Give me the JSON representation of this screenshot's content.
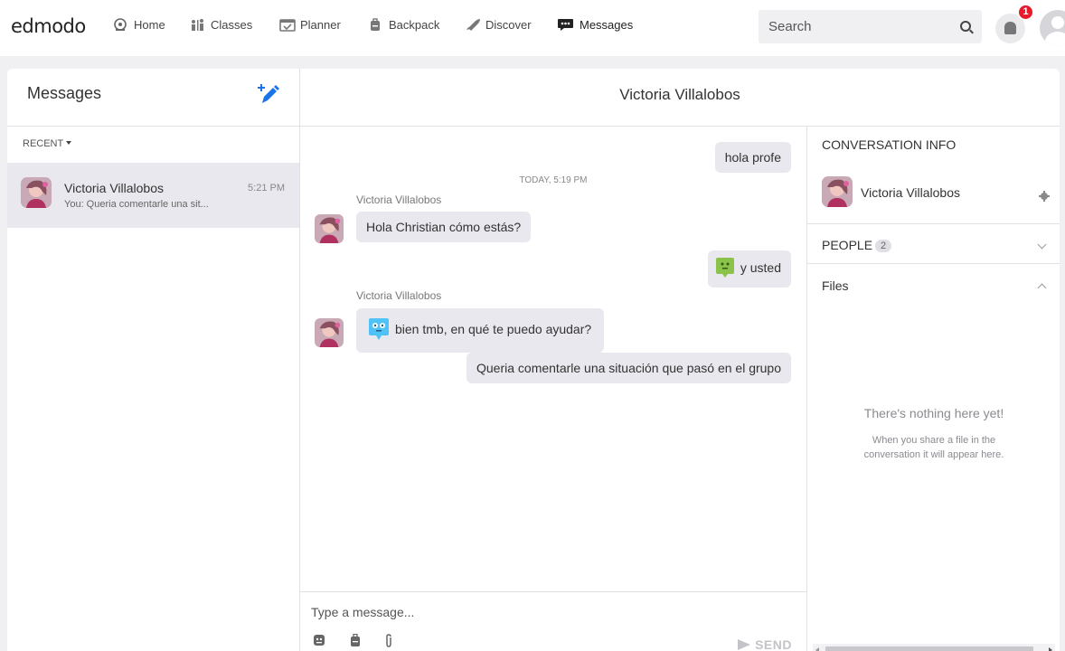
{
  "app": {
    "logo": "edmodo"
  },
  "nav": [
    {
      "label": "Home",
      "icon": "home-icon"
    },
    {
      "label": "Classes",
      "icon": "classes-icon"
    },
    {
      "label": "Planner",
      "icon": "planner-icon"
    },
    {
      "label": "Backpack",
      "icon": "backpack-icon"
    },
    {
      "label": "Discover",
      "icon": "rocket-icon"
    },
    {
      "label": "Messages",
      "icon": "messages-icon"
    }
  ],
  "search": {
    "placeholder": "Search"
  },
  "notifications": {
    "count": "1"
  },
  "sidebar": {
    "title": "Messages",
    "filter_label": "RECENT",
    "conversation": {
      "name": "Victoria Villalobos",
      "time": "5:21 PM",
      "preview": "You: Queria comentarle una sit..."
    }
  },
  "chat": {
    "title": "Victoria Villalobos",
    "timestamp": "TODAY, 5:19 PM",
    "messages": [
      {
        "from": "me",
        "text": "hola profe"
      },
      {
        "from": "them",
        "sender": "Victoria Villalobos",
        "text": "Hola Christian cómo estás?"
      },
      {
        "from": "me",
        "text": "y usted",
        "sticker": "green-monster-sticker"
      },
      {
        "from": "them",
        "sender": "Victoria Villalobos",
        "text": "bien tmb, en qué te puedo ayudar?",
        "sticker": "blue-monster-sticker"
      },
      {
        "from": "me",
        "text": "Queria comentarle una situación que pasó en el grupo"
      }
    ],
    "composer": {
      "placeholder": "Type a message...",
      "send_label": "SEND"
    }
  },
  "info": {
    "title": "CONVERSATION INFO",
    "participant": "Victoria Villalobos",
    "people_label": "PEOPLE",
    "people_count": "2",
    "files_label": "Files",
    "empty_title": "There's nothing here yet!",
    "empty_sub": "When you share a file in the conversation it will appear here."
  },
  "colors": {
    "accent": "#1a73e8",
    "badge": "#e8192c",
    "bubble": "#e8e8ee",
    "sticker_green": "#8bc34a",
    "sticker_blue": "#4fc3f7"
  }
}
